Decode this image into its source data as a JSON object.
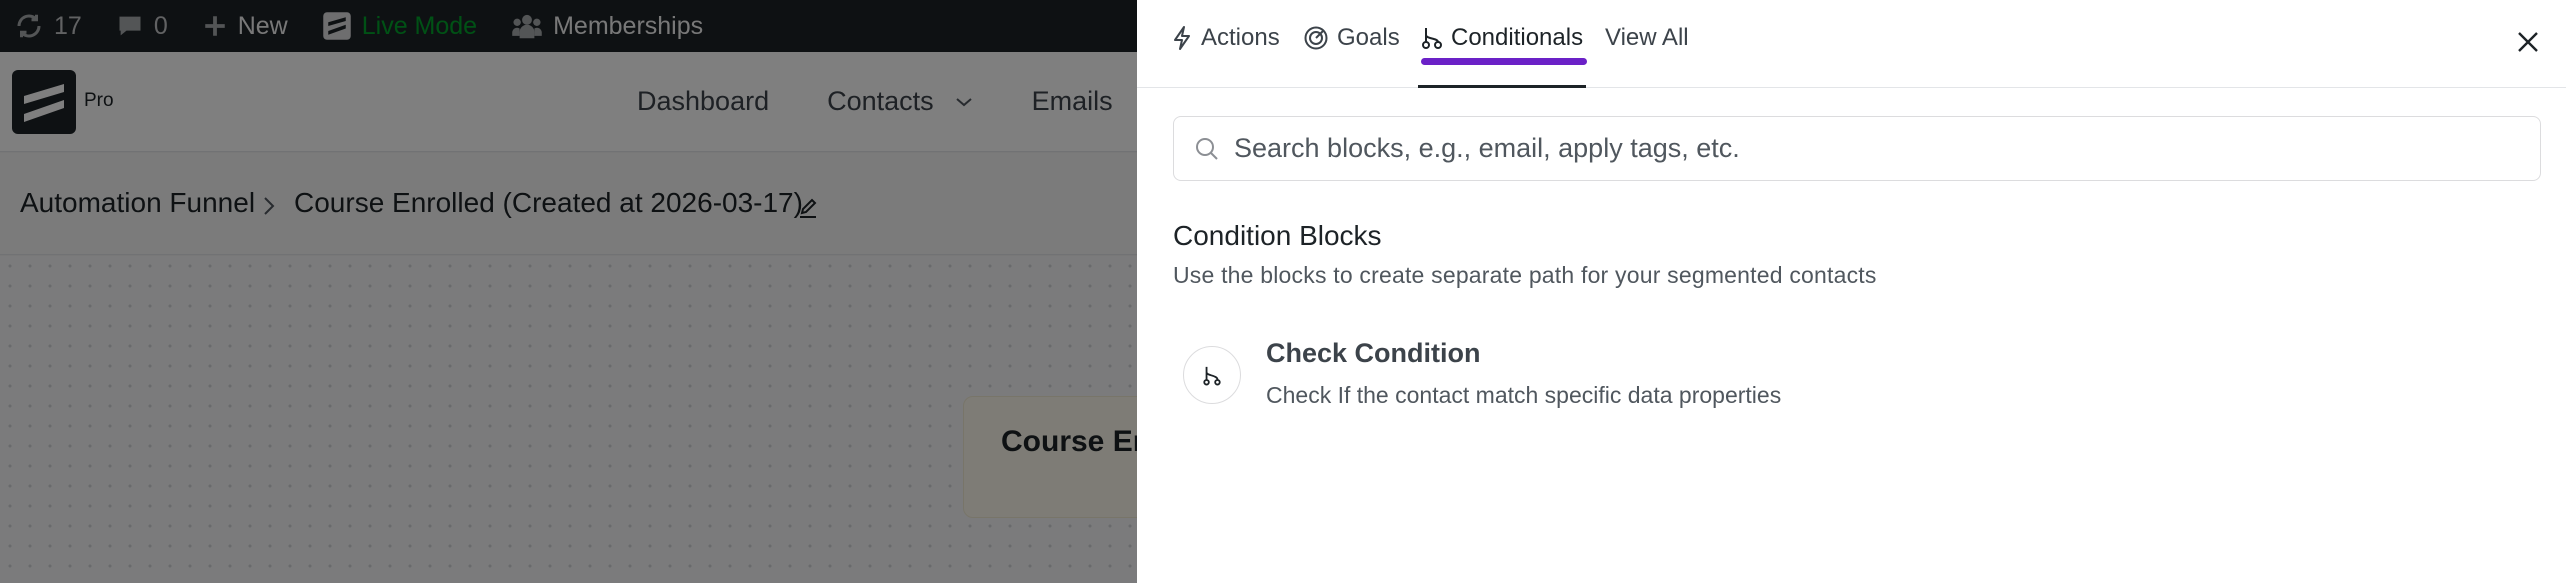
{
  "adminbar": {
    "updates_count": "17",
    "comments_count": "0",
    "new_label": "New",
    "live_mode_label": "Live Mode",
    "memberships_label": "Memberships"
  },
  "header": {
    "logo_badge": "Pro",
    "nav": {
      "dashboard": "Dashboard",
      "contacts": "Contacts",
      "emails": "Emails"
    }
  },
  "breadcrumb": {
    "root": "Automation Funnel",
    "current": "Course Enrolled (Created at 2026-03-17)"
  },
  "canvas": {
    "node_title": "Course En"
  },
  "drawer": {
    "tabs": [
      {
        "label": "Actions",
        "icon": "lightning-icon"
      },
      {
        "label": "Goals",
        "icon": "target-icon"
      },
      {
        "label": "Conditionals",
        "icon": "branch-icon",
        "active": true
      },
      {
        "label": "View All"
      }
    ],
    "search": {
      "placeholder": "Search blocks, e.g., email, apply tags, etc.",
      "value": ""
    },
    "section": {
      "title": "Condition Blocks",
      "description": "Use the blocks to create separate path for your segmented contacts"
    },
    "blocks": [
      {
        "title": "Check Condition",
        "description": "Check If the contact match specific data properties",
        "icon": "branch-icon"
      }
    ]
  },
  "colors": {
    "accent": "#6b21c7",
    "live_mode": "#00a32a",
    "adminbar_bg": "#1d2327",
    "node_bg": "#fdf9ec"
  }
}
